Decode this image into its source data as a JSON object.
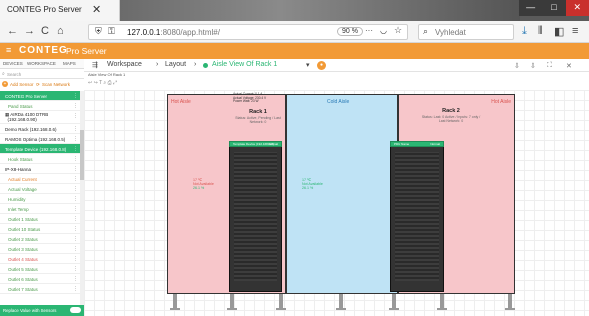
{
  "browser": {
    "tab_title": "CONTEG Pro Server",
    "url_host": "127.0.0.1",
    "url_path": ":8080/app.html#/",
    "zoom": "90 %",
    "search_placeholder": "Vyhledat",
    "win_min": "—",
    "win_max": "□",
    "win_close": "✕",
    "back": "←",
    "forward": "→",
    "reload": "C",
    "home": "⌂",
    "menu": "≡"
  },
  "app": {
    "brand": "CONTEG",
    "brand_sub": "Pro Server",
    "menu_icon": "≡",
    "accent": "#f29a36",
    "green": "#2bb673"
  },
  "left": {
    "tabs": [
      "DEVICES",
      "WORKSPACE",
      "MAPS"
    ],
    "search_placeholder": "Search",
    "add_sensor": "Add Sensor",
    "scan_network": "Scan Network",
    "tree": [
      {
        "label": "CONTEG Pro Server",
        "style": "green"
      },
      {
        "label": "Pand Status",
        "style": "sub"
      },
      {
        "label": "AIRDa 4100 DTRB",
        "label2": "(192.168.0.90)",
        "style": "device"
      },
      {
        "label": "Demo Rack (192.168.0.6)",
        "style": "device"
      },
      {
        "label": "RAMOS Optima (192.168.0.5)",
        "style": "device"
      },
      {
        "label": "Template Device (192.168.0.8)",
        "style": "green"
      },
      {
        "label": "Hook Status",
        "style": "sub"
      },
      {
        "label": "IP-X8-Hanna",
        "style": "device"
      },
      {
        "label": "Actual Current",
        "style": "sub org"
      },
      {
        "label": "Actual Voltage",
        "style": "sub"
      },
      {
        "label": "Humidity",
        "style": "sub"
      },
      {
        "label": "Inlet Temp",
        "style": "sub"
      },
      {
        "label": "Outlet 1 Status",
        "style": "sub"
      },
      {
        "label": "Outlet 10 Status",
        "style": "sub"
      },
      {
        "label": "Outlet 2 Status",
        "style": "sub"
      },
      {
        "label": "Outlet 3 Status",
        "style": "sub"
      },
      {
        "label": "Outlet 4 Status",
        "style": "sub red"
      },
      {
        "label": "Outlet 5 Status",
        "style": "sub"
      },
      {
        "label": "Outlet 6 Status",
        "style": "sub"
      },
      {
        "label": "Outlet 7 Status",
        "style": "sub"
      }
    ],
    "footer": "Replace Value with Sensors"
  },
  "main": {
    "crumbs": [
      "Workspace",
      "Layout",
      "Aisle View Of Rack 1"
    ],
    "canvas_title": "Aisle View Of Rack 1",
    "canvas_tools": "↩  ↪  T  ⌕  ⎙  ⤢",
    "right_tools": [
      "⇩",
      "⇩",
      "⛶",
      "✕"
    ],
    "top_info": [
      "Actual Current: 0.1 A",
      "Actual Voltage: 230.4 V",
      "Power Watt: 23 W"
    ]
  },
  "zones": {
    "hot_left": "Hot Aisle",
    "cold": "Cold Aisle",
    "hot_right": "Hot Aisle"
  },
  "racks": [
    {
      "title": "Rack 1",
      "sub": "Status: Active, Pending / Last Network: 0",
      "head": "Template Device (192.168.0.8)",
      "head_status": "Normal"
    },
    {
      "title": "Rack 2",
      "sub": "Status: Last: 0 Active / Inputs: 7 only / Last Network: 0",
      "head": "PDU Name",
      "head_status": "Normal"
    }
  ],
  "sensors": {
    "left_temp": "17 ℃",
    "left_note": "Not Available",
    "left_hum": "26.1 %",
    "mid_temp": "17 ℃",
    "mid_note": "Not Available",
    "mid_hum": "26.1 %"
  }
}
